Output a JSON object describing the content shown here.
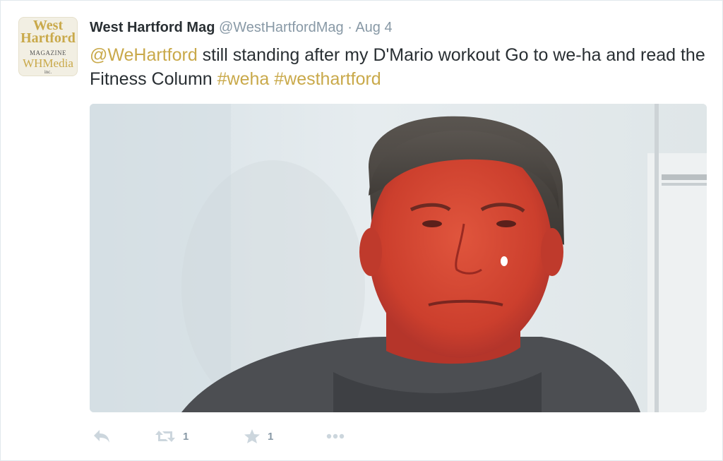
{
  "tweet": {
    "fullname": "West Hartford Mag",
    "username": "@WestHartfordMag",
    "separator": "·",
    "date": "Aug 4",
    "text": {
      "mention": "@WeHartford",
      "body_line": " still standing after my D'Mario workout Go to we-ha and read the Fitness Column ",
      "hashtag1": "#weha",
      "space": " ",
      "hashtag2": "#westhartford"
    },
    "avatar": {
      "line1": "West",
      "line2": "Hartford",
      "line3": "MAGAZINE",
      "line4": "WHMedia",
      "line5": "inc."
    },
    "media_description": "selfie-photo",
    "actions": {
      "reply_icon": "reply-icon",
      "retweet_icon": "retweet-icon",
      "retweet_count": "1",
      "favorite_icon": "star-icon",
      "favorite_count": "1",
      "more_icon": "more-dots-icon"
    }
  },
  "colors": {
    "link": "#c9a94a",
    "text": "#292f33",
    "muted": "#8899a6",
    "icon": "#ccd6dd",
    "border": "#e1e8ed"
  }
}
